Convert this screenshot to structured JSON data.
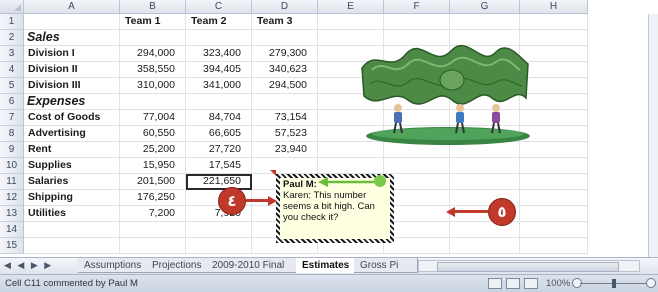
{
  "columns": [
    "A",
    "B",
    "C",
    "D",
    "E",
    "F",
    "G",
    "H"
  ],
  "rows": [
    {
      "n": "1",
      "a": "",
      "b": "Team 1",
      "c": "Team 2",
      "d": "Team 3",
      "kind": "hdr"
    },
    {
      "n": "2",
      "a": "Sales",
      "b": "",
      "c": "",
      "d": "",
      "kind": "section"
    },
    {
      "n": "3",
      "a": "Division I",
      "b": "294,000",
      "c": "323,400",
      "d": "279,300",
      "kind": "data"
    },
    {
      "n": "4",
      "a": "Division II",
      "b": "358,550",
      "c": "394,405",
      "d": "340,623",
      "kind": "data"
    },
    {
      "n": "5",
      "a": "Division III",
      "b": "310,000",
      "c": "341,000",
      "d": "294,500",
      "kind": "data"
    },
    {
      "n": "6",
      "a": "Expenses",
      "b": "",
      "c": "",
      "d": "",
      "kind": "section"
    },
    {
      "n": "7",
      "a": "Cost of Goods",
      "b": "77,004",
      "c": "84,704",
      "d": "73,154",
      "kind": "data"
    },
    {
      "n": "8",
      "a": "Advertising",
      "b": "60,550",
      "c": "66,605",
      "d": "57,523",
      "kind": "data"
    },
    {
      "n": "9",
      "a": "Rent",
      "b": "25,200",
      "c": "27,720",
      "d": "23,940",
      "kind": "data"
    },
    {
      "n": "10",
      "a": "Supplies",
      "b": "15,950",
      "c": "17,545",
      "d": "",
      "kind": "data"
    },
    {
      "n": "11",
      "a": "Salaries",
      "b": "201,500",
      "c": "221,650",
      "d": "",
      "kind": "data"
    },
    {
      "n": "12",
      "a": "Shipping",
      "b": "176,250",
      "c": "",
      "d": "",
      "kind": "data"
    },
    {
      "n": "13",
      "a": "Utilities",
      "b": "7,200",
      "c": "7,920",
      "d": "",
      "kind": "data"
    },
    {
      "n": "14",
      "a": "",
      "b": "",
      "c": "",
      "d": "",
      "kind": "data"
    },
    {
      "n": "15",
      "a": "",
      "b": "",
      "c": "",
      "d": "",
      "kind": "data"
    }
  ],
  "comment": {
    "author": "Paul M:",
    "text": "Karen: This number seems a bit high. Can you check it?"
  },
  "callouts": {
    "four": "٤",
    "five": "٥"
  },
  "sheet_nav": "◀ ◀ ▶ ▶",
  "tabs": [
    "Assumptions",
    "Projections",
    "2009-2010 Final",
    "Estimates",
    "Gross Pi"
  ],
  "active_tab": "Estimates",
  "status": {
    "message": "Cell C11 commented by Paul M",
    "zoom": "100%"
  },
  "colors": {
    "accent": "#c0392b",
    "comment_bg": "#ffffe1",
    "money_green": "#3f7a3a"
  }
}
